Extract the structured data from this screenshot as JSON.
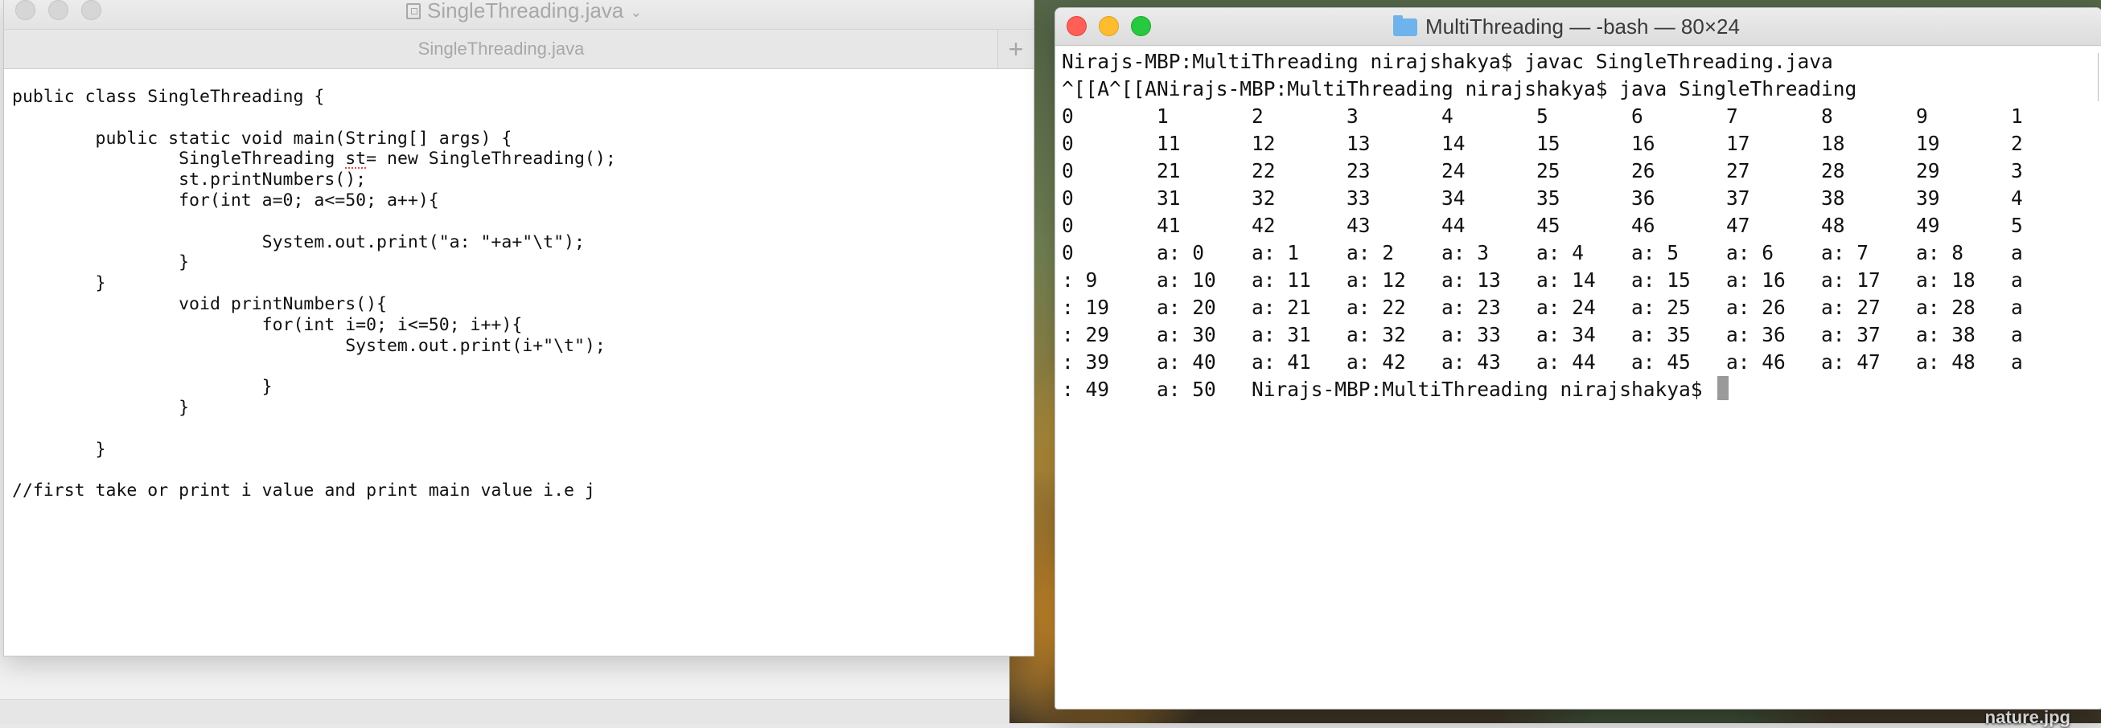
{
  "editor": {
    "title": "SingleThreading.java",
    "tab_label": "SingleThreading.java",
    "add_tab_symbol": "+",
    "code_lines": [
      "public class SingleThreading {",
      "",
      "        public static void main(String[] args) {",
      "                SingleThreading st= new SingleThreading();",
      "                st.printNumbers();",
      "                for(int a=0; a<=50; a++){",
      "",
      "                        System.out.print(\"a: \"+a+\"\\t\");",
      "                }",
      "        }",
      "                void printNumbers(){",
      "                        for(int i=0; i<=50; i++){",
      "                                System.out.print(i+\"\\t\");",
      "",
      "                        }",
      "                }",
      "",
      "        }",
      "",
      "//first take or print i value and print main value i.e j"
    ]
  },
  "terminal": {
    "title": "MultiThreading — -bash — 80×24",
    "lines": [
      "Nirajs-MBP:MultiThreading nirajshakya$ javac SingleThreading.java",
      "^[[A^[[ANirajs-MBP:MultiThreading nirajshakya$ java SingleThreading",
      "0       1       2       3       4       5       6       7       8       9       1",
      "0       11      12      13      14      15      16      17      18      19      2",
      "0       21      22      23      24      25      26      27      28      29      3",
      "0       31      32      33      34      35      36      37      38      39      4",
      "0       41      42      43      44      45      46      47      48      49      5",
      "0       a: 0    a: 1    a: 2    a: 3    a: 4    a: 5    a: 6    a: 7    a: 8    a",
      ": 9     a: 10   a: 11   a: 12   a: 13   a: 14   a: 15   a: 16   a: 17   a: 18   a",
      ": 19    a: 20   a: 21   a: 22   a: 23   a: 24   a: 25   a: 26   a: 27   a: 28   a",
      ": 29    a: 30   a: 31   a: 32   a: 33   a: 34   a: 35   a: 36   a: 37   a: 38   a",
      ": 39    a: 40   a: 41   a: 42   a: 43   a: 44   a: 45   a: 46   a: 47   a: 48   a",
      ": 49    a: 50   Nirajs-MBP:MultiThreading nirajshakya$ "
    ]
  },
  "desktop": {
    "file_label": "nature.jpg"
  },
  "colors": {
    "close": "#fe5f57",
    "minimize": "#febc2e",
    "zoom": "#28c840",
    "folder": "#6fb3ec"
  },
  "icons": [
    "document-icon",
    "folder-icon",
    "close-icon",
    "minimize-icon",
    "zoom-icon",
    "chevron-down-icon",
    "plus-icon"
  ]
}
